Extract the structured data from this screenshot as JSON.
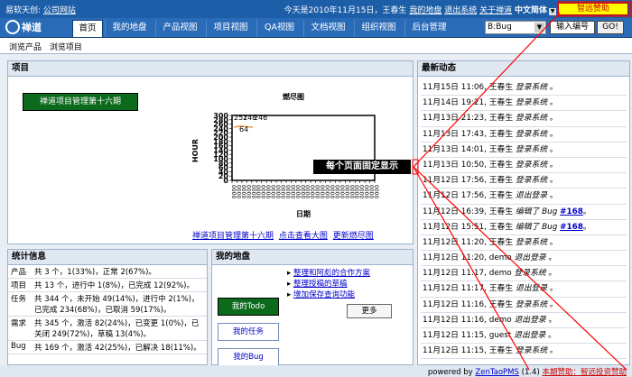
{
  "topbar": {
    "company": "易软天创",
    "company_link": "公司网站",
    "today": "今天是2010年11月15日，王春生",
    "links": [
      "我的地盘",
      "退出系统",
      "关于禅道"
    ],
    "language": "中文简体",
    "sponsor": "智远赞助"
  },
  "navbar": {
    "logo": "禅道",
    "tabs": [
      "首页",
      "我的地盘",
      "产品视图",
      "项目视图",
      "QA视图",
      "文档视图",
      "组织视图",
      "后台管理"
    ],
    "active_tab": "首页",
    "select_value": "B:Bug",
    "jump_label": "输入编号",
    "go_label": "GO!"
  },
  "subnav": {
    "items": [
      "浏览产品",
      "浏览项目"
    ]
  },
  "project_panel": {
    "title": "项目",
    "project_button": "禅道项目管理第十六期",
    "chart_title": "燃尽图",
    "footer_links": [
      "禅道项目管理第十六期",
      "点击查看大图",
      "更新燃尽图"
    ]
  },
  "chart_data": {
    "type": "line",
    "title": "燃尽图",
    "xlabel": "日期",
    "ylabel": "HOUR",
    "ylim": [
      0,
      300
    ],
    "y_ticks": [
      0,
      20,
      40,
      60,
      80,
      100,
      120,
      140,
      160,
      180,
      200,
      220,
      240,
      260,
      280,
      300
    ],
    "y_tick_labels": [
      "0",
      "20",
      "40",
      "60",
      "80",
      "100",
      "120",
      "140",
      "160",
      "180",
      "200",
      "220",
      "240",
      "260",
      "280",
      "300"
    ],
    "x_tick_count": 30,
    "series": [
      {
        "values": [
          246,
          251,
          248,
          246
        ]
      }
    ],
    "data_labels": [
      "251",
      "248",
      "246",
      "64"
    ]
  },
  "callout": "每个页面固定显示",
  "news": {
    "title": "最新动态",
    "rows": [
      {
        "date": "11月15日",
        "time": "11:06",
        "user": "王春生",
        "action": "登录系统",
        "link": ""
      },
      {
        "date": "11月14日",
        "time": "19:21",
        "user": "王春生",
        "action": "登录系统",
        "link": ""
      },
      {
        "date": "11月13日",
        "time": "21:23",
        "user": "王春生",
        "action": "登录系统",
        "link": ""
      },
      {
        "date": "11月13日",
        "time": "17:43",
        "user": "王春生",
        "action": "登录系统",
        "link": ""
      },
      {
        "date": "11月13日",
        "time": "14:01",
        "user": "王春生",
        "action": "登录系统",
        "link": ""
      },
      {
        "date": "11月13日",
        "time": "10:50",
        "user": "王春生",
        "action": "登录系统",
        "link": ""
      },
      {
        "date": "11月12日",
        "time": "17:56",
        "user": "王春生",
        "action": "登录系统",
        "link": ""
      },
      {
        "date": "11月12日",
        "time": "17:56",
        "user": "王春生",
        "action": "退出登录",
        "link": ""
      },
      {
        "date": "11月12日",
        "time": "16:39",
        "user": "王春生",
        "action": "编辑了 Bug",
        "link": "#168"
      },
      {
        "date": "11月12日",
        "time": "15:51",
        "user": "王春生",
        "action": "编辑了 Bug",
        "link": "#168"
      },
      {
        "date": "11月12日",
        "time": "11:20",
        "user": "王春生",
        "action": "登录系统",
        "link": ""
      },
      {
        "date": "11月12日",
        "time": "11:20",
        "user": "demo",
        "action": "退出登录",
        "link": ""
      },
      {
        "date": "11月12日",
        "time": "11:17",
        "user": "demo",
        "action": "登录系统",
        "link": ""
      },
      {
        "date": "11月12日",
        "time": "11:17",
        "user": "王春生",
        "action": "退出登录",
        "link": ""
      },
      {
        "date": "11月12日",
        "time": "11:16",
        "user": "王春生",
        "action": "登录系统",
        "link": ""
      },
      {
        "date": "11月12日",
        "time": "11:16",
        "user": "demo",
        "action": "退出登录",
        "link": ""
      },
      {
        "date": "11月12日",
        "time": "11:15",
        "user": "guest",
        "action": "退出登录",
        "link": ""
      },
      {
        "date": "11月12日",
        "time": "11:15",
        "user": "王春生",
        "action": "登录系统",
        "link": ""
      }
    ]
  },
  "stats": {
    "title": "统计信息",
    "rows": [
      {
        "key": "产品",
        "text": "共 3 个，1(33%)，正常 2(67%)。"
      },
      {
        "key": "项目",
        "text": "共 13 个，进行中 1(8%)，已完成 12(92%)。"
      },
      {
        "key": "任务",
        "text": "共 344 个，未开始 49(14%)，进行中 2(1%)，已完成 234(68%)，已取消 59(17%)。"
      },
      {
        "key": "需求",
        "text": "共 345 个，激活 82(24%)，已变更 1(0%)，已关闭 249(72%)，草稿 13(4%)。"
      },
      {
        "key": "Bug",
        "text": "共 169 个，激活 42(25%)，已解决 18(11%)。"
      }
    ]
  },
  "myland": {
    "title": "我的地盘",
    "buttons": [
      "我的Todo",
      "我的任务",
      "我的Bug"
    ],
    "todos": [
      "整理和阿彪的合作方案",
      "整理授稿的草稿",
      "增加保存查询功能"
    ],
    "more": "更多"
  },
  "footer": {
    "powered": "powered by",
    "product": "ZenTaoPMS",
    "version": "(1.4)",
    "sponsor": "本期赞助：智远投资赞助"
  },
  "colors": {
    "nav_blue": "#1d5ea8",
    "green_button": "#0b6a1c",
    "callout_red": "#ff0000"
  }
}
